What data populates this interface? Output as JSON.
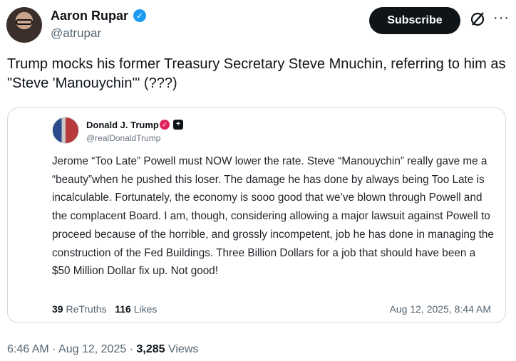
{
  "author": {
    "name": "Aaron Rupar",
    "handle": "@atrupar"
  },
  "header": {
    "subscribe_label": "Subscribe",
    "grok_icon": "grok-icon",
    "more_icon": "more-icon",
    "more_glyph": "···"
  },
  "tweet": {
    "text": "Trump mocks his former Treasury Secretary Steve Mnuchin, referring to him as \"Steve 'Manouychin'\" (???)"
  },
  "quoted": {
    "name": "Donald J. Trump",
    "handle": "@realDonaldTrump",
    "body": "Jerome “Too Late” Powell must NOW lower the rate. Steve “Manouychin” really gave me a “beauty”when he pushed this loser. The damage he has done by always being Too Late is incalculable. Fortunately, the economy is sooo good that we’ve blown through Powell and the complacent Board. I am, though, considering allowing a major lawsuit against Powell to proceed because of the horrible, and grossly incompetent, job he has done in managing the construction of the Fed Buildings. Three Billion Dollars for a job that should have been a $50 Million Dollar fix up. Not good!",
    "retruths_count": "39",
    "retruths_label": "ReTruths",
    "likes_count": "116",
    "likes_label": "Likes",
    "date": "Aug 12, 2025, 8:44 AM"
  },
  "footer": {
    "time": "6:46 AM",
    "separator": "·",
    "date": "Aug 12, 2025",
    "views_count": "3,285",
    "views_label": "Views"
  },
  "colors": {
    "verified": "#1d9bf0",
    "text_primary": "#0f1419",
    "text_secondary": "#536471",
    "border": "#cfd9de"
  }
}
